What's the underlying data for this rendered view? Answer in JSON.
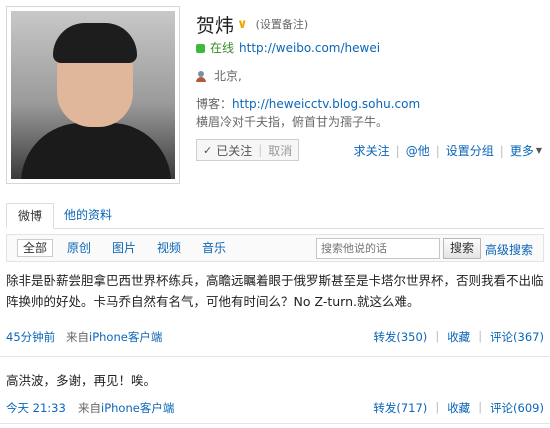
{
  "profile": {
    "name": "贺炜",
    "remark": "(设置备注)",
    "online_label": "在线",
    "weibo_url": "http://weibo.com/hewei",
    "location": "北京,",
    "blog_label": "博客：",
    "blog_url": "http://heweicctv.blog.sohu.com",
    "bio": "横眉冷对千夫指，俯首甘为孺子牛。",
    "followed_label": "已关注",
    "unfollow_label": "取消",
    "actions": [
      "求关注",
      "@他",
      "设置分组",
      "更多"
    ]
  },
  "tabs": {
    "active": "微博",
    "other": "他的资料"
  },
  "filters": [
    "全部",
    "原创",
    "图片",
    "视频",
    "音乐"
  ],
  "search": {
    "placeholder": "搜索他说的话",
    "button": "搜索",
    "advanced": "高级搜索"
  },
  "posts": [
    {
      "text": "除非是卧薪尝胆拿巴西世界杯练兵，高瞻远瞩着眼于俄罗斯甚至是卡塔尔世界杯，否则我看不出临阵换帅的好处。卡马乔自然有名气，可他有时间么？No Z-turn.就这么难。",
      "time": "45分钟前",
      "from_prefix": "来自",
      "source": "iPhone客户端",
      "repost": "转发(350)",
      "favorite": "收藏",
      "comment": "评论(367)"
    },
    {
      "text": "高洪波，多谢，再见！唉。",
      "time": "今天 21:33",
      "from_prefix": "来自",
      "source": "iPhone客户端",
      "repost": "转发(717)",
      "favorite": "收藏",
      "comment": "评论(609)"
    }
  ],
  "colors": {
    "link": "#0a66b7",
    "online": "#3cba3c",
    "verified": "#f0a500"
  }
}
